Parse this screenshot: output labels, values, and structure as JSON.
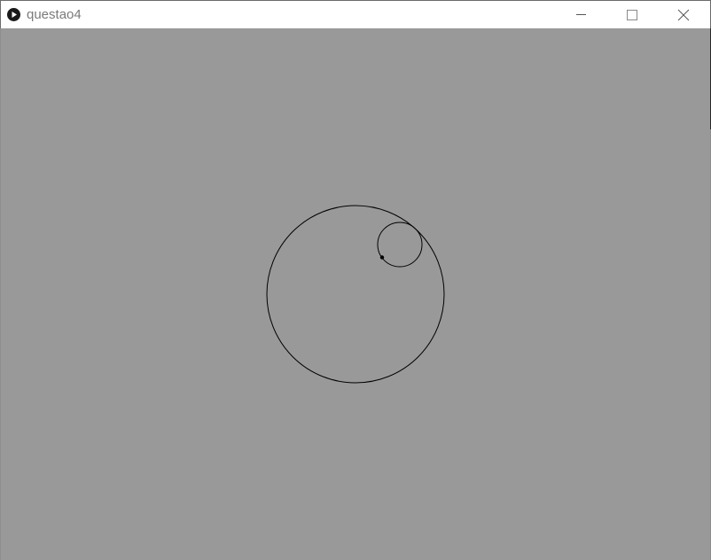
{
  "window": {
    "title": "questao4",
    "app_icon": "play-circle-icon",
    "controls": {
      "minimize_icon": "minimize-icon",
      "maximize_icon": "maximize-icon",
      "close_icon": "close-icon"
    }
  },
  "colors": {
    "canvas_background": "#999999",
    "titlebar_background": "#ffffff",
    "stroke": "#000000",
    "title_text": "#7a7a7a"
  },
  "sketch": {
    "big_circle": {
      "diameter": 200
    },
    "small_circle": {
      "diameter": 50
    },
    "tracing_point": "point"
  }
}
